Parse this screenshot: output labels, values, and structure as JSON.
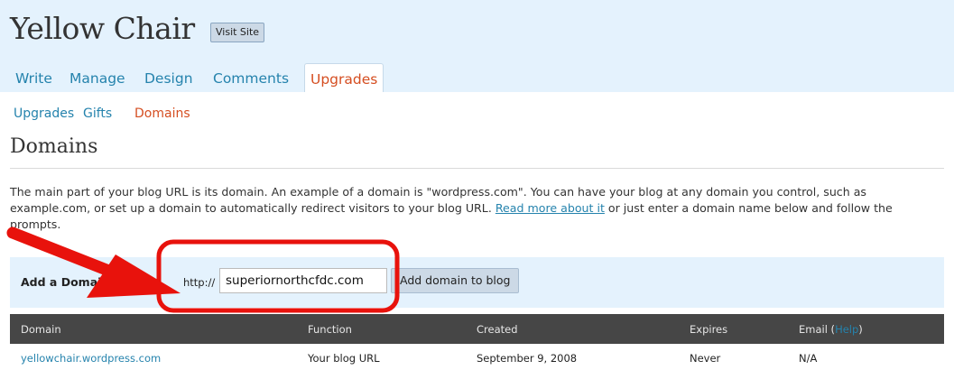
{
  "header": {
    "site_title": "Yellow Chair",
    "visit_site_label": "Visit Site"
  },
  "tabs": [
    {
      "label": "Write",
      "active": false
    },
    {
      "label": "Manage",
      "active": false
    },
    {
      "label": "Design",
      "active": false
    },
    {
      "label": "Comments",
      "active": false
    },
    {
      "label": "Upgrades",
      "active": true
    }
  ],
  "subnav": [
    {
      "label": "Upgrades",
      "active": false
    },
    {
      "label": "Gifts",
      "active": false
    },
    {
      "label": "Domains",
      "active": true
    }
  ],
  "page": {
    "title": "Domains",
    "description_before_link": "The main part of your blog URL is its domain. An example of a domain is \"wordpress.com\". You can have your blog at any domain you control, such as example.com, or set up a domain to automatically redirect visitors to your blog URL. ",
    "description_link": "Read more about it",
    "description_after_link": " or just enter a domain name below and follow the prompts."
  },
  "add_domain": {
    "label": "Add a Domain",
    "prefix": "http://",
    "input_value": "superiornorthcfdc.com",
    "button_label": "Add domain to blog"
  },
  "table": {
    "headers": {
      "domain": "Domain",
      "function": "Function",
      "created": "Created",
      "expires": "Expires",
      "email": "Email (",
      "email_help": "Help",
      "email_close": ")"
    },
    "rows": [
      {
        "domain": "yellowchair.wordpress.com",
        "function": "Your blog URL",
        "created": "September 9, 2008",
        "expires": "Never",
        "email": "N/A"
      }
    ]
  },
  "colors": {
    "link": "#2583ad",
    "active": "#d54e21",
    "header_bg": "#e4f2fd",
    "table_header_bg": "#464646",
    "annotation_red": "#e8120c"
  }
}
